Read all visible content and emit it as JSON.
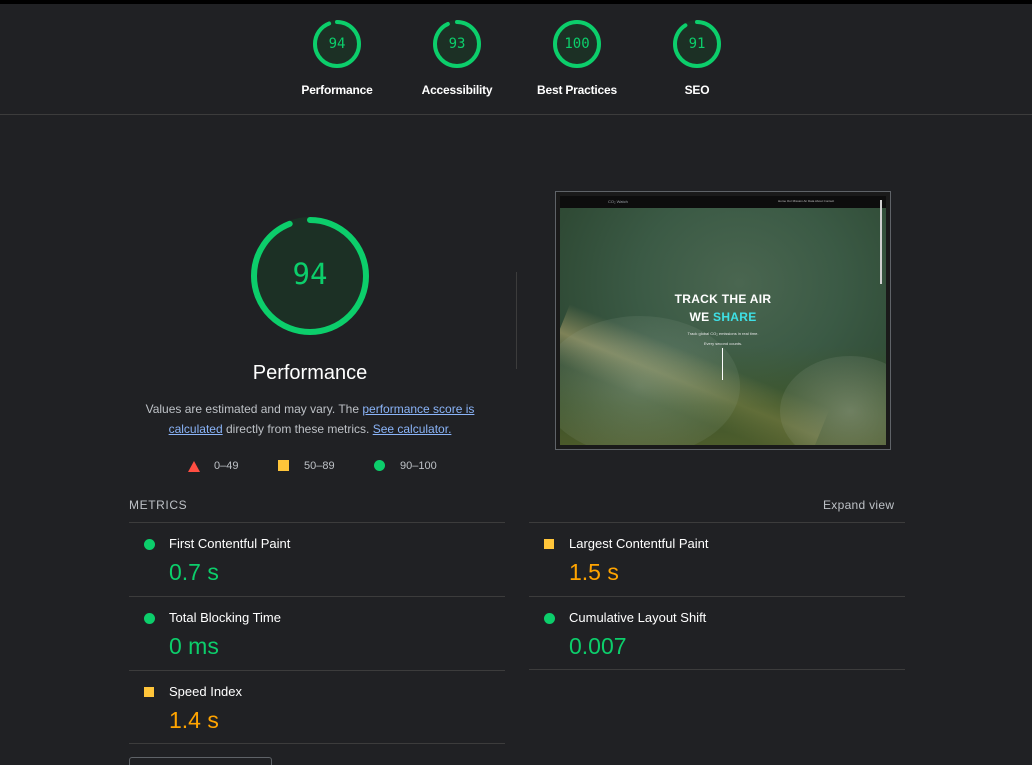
{
  "summary": [
    {
      "score": "94",
      "value": 94,
      "label": "Performance"
    },
    {
      "score": "93",
      "value": 93,
      "label": "Accessibility"
    },
    {
      "score": "100",
      "value": 100,
      "label": "Best Practices"
    },
    {
      "score": "91",
      "value": 91,
      "label": "SEO"
    }
  ],
  "colors": {
    "pass": "#0cce6b",
    "average": "#ffa400",
    "average_icon": "#ffc53a",
    "fail": "#ff4e42",
    "background": "#202124"
  },
  "performance": {
    "score": "94",
    "value": 94,
    "title": "Performance",
    "desc_prefix": "Values are estimated and may vary. The ",
    "score_link": "performance score is calculated",
    "desc_middle": " directly from these metrics. ",
    "calculator_link": "See calculator.",
    "legend": {
      "fail": "0–49",
      "average": "50–89",
      "pass": "90–100"
    }
  },
  "thumbnail": {
    "logo": "CO₂ Watch",
    "nav_links": "Home   Our Mission   Air Data   About   Contact",
    "hero_line1": "TRACK THE AIR",
    "hero_line2_a": "WE ",
    "hero_line2_b": "SHARE",
    "hero_sub1": "Track global CO₂ emissions in real time.",
    "hero_sub2": "Every second counts."
  },
  "metrics": {
    "title": "METRICS",
    "expand_label": "Expand view",
    "items": [
      {
        "name": "First Contentful Paint",
        "value": "0.7 s",
        "status": "pass"
      },
      {
        "name": "Largest Contentful Paint",
        "value": "1.5 s",
        "status": "average"
      },
      {
        "name": "Total Blocking Time",
        "value": "0 ms",
        "status": "pass"
      },
      {
        "name": "Cumulative Layout Shift",
        "value": "0.007",
        "status": "pass"
      },
      {
        "name": "Speed Index",
        "value": "1.4 s",
        "status": "average"
      }
    ]
  }
}
